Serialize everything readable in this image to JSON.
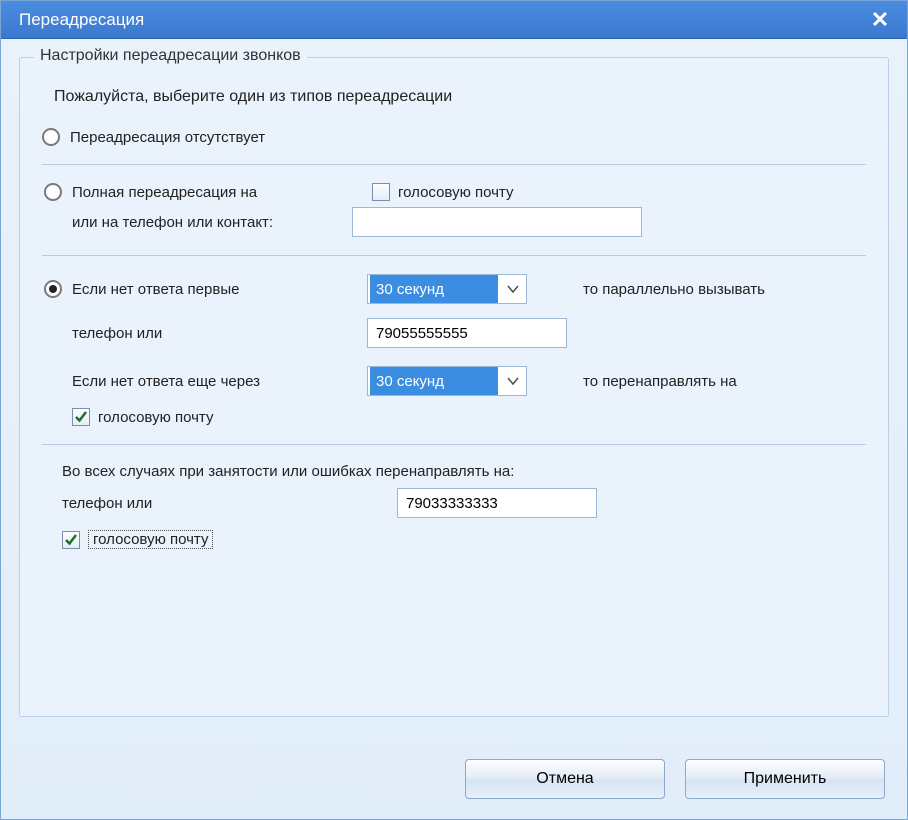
{
  "window": {
    "title": "Переадресация"
  },
  "group": {
    "label": "Настройки переадресации звонков",
    "instruction": "Пожалуйста, выберите один из типов переадресации"
  },
  "option_none": {
    "label": "Переадресация отсутствует",
    "selected": false
  },
  "option_full": {
    "label": "Полная переадресация  на",
    "sub_label": "или на телефон или контакт:",
    "voicemail_label": "голосовую почту",
    "voicemail_checked": false,
    "phone_value": "",
    "selected": false
  },
  "option_cond": {
    "selected": true,
    "line1_prefix": "Если нет ответа первые",
    "timeout1": "30 секунд",
    "line1_suffix": "то параллельно вызывать",
    "line2_prefix": "телефон или",
    "phone1": "79055555555",
    "line3_prefix": "Если нет ответа еще через",
    "timeout2": "30 секунд",
    "line3_suffix": "то перенаправлять на",
    "voicemail_label": "голосовую почту",
    "voicemail_checked": true
  },
  "busy": {
    "heading": "Во всех случаях при занятости или ошибках перенаправлять на:",
    "phone_label": "телефон или",
    "phone": "79033333333",
    "voicemail_label": "голосовую почту",
    "voicemail_checked": true
  },
  "buttons": {
    "cancel": "Отмена",
    "apply": "Применить"
  }
}
